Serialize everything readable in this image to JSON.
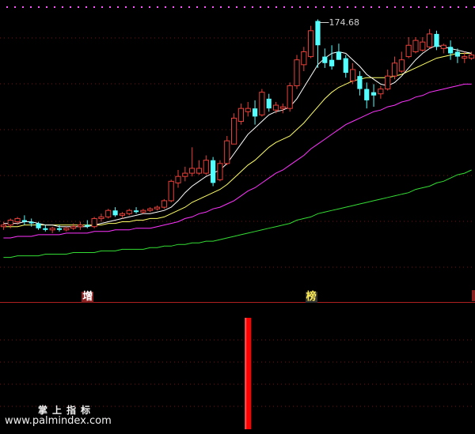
{
  "chart_data": {
    "type": "candlestick",
    "price_high_label": "174.68",
    "price_range": [
      20,
      185
    ],
    "candles": [
      {
        "o": 48,
        "h": 50,
        "l": 45,
        "c": 47,
        "up": true
      },
      {
        "o": 48,
        "h": 52,
        "l": 46,
        "c": 51,
        "up": true
      },
      {
        "o": 50,
        "h": 53,
        "l": 48,
        "c": 52,
        "up": true
      },
      {
        "o": 51,
        "h": 54,
        "l": 48,
        "c": 50,
        "up": false
      },
      {
        "o": 50,
        "h": 52,
        "l": 47,
        "c": 49,
        "up": false
      },
      {
        "o": 49,
        "h": 50,
        "l": 45,
        "c": 46,
        "up": false
      },
      {
        "o": 46,
        "h": 48,
        "l": 44,
        "c": 45,
        "up": false
      },
      {
        "o": 45,
        "h": 47,
        "l": 43,
        "c": 46,
        "up": true
      },
      {
        "o": 46,
        "h": 48,
        "l": 44,
        "c": 45,
        "up": false
      },
      {
        "o": 45,
        "h": 47,
        "l": 44,
        "c": 46,
        "up": true
      },
      {
        "o": 46,
        "h": 49,
        "l": 45,
        "c": 47,
        "up": true
      },
      {
        "o": 47,
        "h": 50,
        "l": 45,
        "c": 48,
        "up": true
      },
      {
        "o": 48,
        "h": 51,
        "l": 46,
        "c": 47,
        "up": false
      },
      {
        "o": 47,
        "h": 53,
        "l": 46,
        "c": 52,
        "up": true
      },
      {
        "o": 52,
        "h": 55,
        "l": 50,
        "c": 53,
        "up": true
      },
      {
        "o": 53,
        "h": 58,
        "l": 52,
        "c": 57,
        "up": true
      },
      {
        "o": 57,
        "h": 59,
        "l": 53,
        "c": 54,
        "up": false
      },
      {
        "o": 54,
        "h": 56,
        "l": 52,
        "c": 55,
        "up": true
      },
      {
        "o": 55,
        "h": 58,
        "l": 54,
        "c": 57,
        "up": true
      },
      {
        "o": 57,
        "h": 59,
        "l": 55,
        "c": 56,
        "up": false
      },
      {
        "o": 56,
        "h": 58,
        "l": 55,
        "c": 57,
        "up": true
      },
      {
        "o": 57,
        "h": 59,
        "l": 56,
        "c": 58,
        "up": true
      },
      {
        "o": 58,
        "h": 60,
        "l": 57,
        "c": 59,
        "up": true
      },
      {
        "o": 59,
        "h": 64,
        "l": 58,
        "c": 63,
        "up": true
      },
      {
        "o": 63,
        "h": 76,
        "l": 62,
        "c": 75,
        "up": true
      },
      {
        "o": 74,
        "h": 82,
        "l": 71,
        "c": 78,
        "up": true
      },
      {
        "o": 78,
        "h": 84,
        "l": 75,
        "c": 80,
        "up": true
      },
      {
        "o": 80,
        "h": 96,
        "l": 78,
        "c": 83,
        "up": true
      },
      {
        "o": 83,
        "h": 88,
        "l": 79,
        "c": 80,
        "up": true
      },
      {
        "o": 80,
        "h": 91,
        "l": 79,
        "c": 88,
        "up": true
      },
      {
        "o": 88,
        "h": 90,
        "l": 72,
        "c": 74,
        "up": false
      },
      {
        "o": 76,
        "h": 88,
        "l": 75,
        "c": 86,
        "up": true
      },
      {
        "o": 86,
        "h": 103,
        "l": 85,
        "c": 100,
        "up": true
      },
      {
        "o": 98,
        "h": 117,
        "l": 98,
        "c": 114,
        "up": true
      },
      {
        "o": 112,
        "h": 123,
        "l": 110,
        "c": 120,
        "up": true
      },
      {
        "o": 118,
        "h": 124,
        "l": 115,
        "c": 120,
        "up": true
      },
      {
        "o": 120,
        "h": 125,
        "l": 110,
        "c": 115,
        "up": false
      },
      {
        "o": 116,
        "h": 132,
        "l": 115,
        "c": 130,
        "up": true
      },
      {
        "o": 126,
        "h": 129,
        "l": 118,
        "c": 120,
        "up": false
      },
      {
        "o": 119,
        "h": 124,
        "l": 117,
        "c": 122,
        "up": true
      },
      {
        "o": 121,
        "h": 123,
        "l": 117,
        "c": 120,
        "up": true
      },
      {
        "o": 120,
        "h": 136,
        "l": 118,
        "c": 134,
        "up": true
      },
      {
        "o": 134,
        "h": 153,
        "l": 132,
        "c": 150,
        "up": true
      },
      {
        "o": 147,
        "h": 158,
        "l": 143,
        "c": 155,
        "up": true
      },
      {
        "o": 152,
        "h": 171,
        "l": 151,
        "c": 168,
        "up": true
      },
      {
        "o": 174,
        "h": 175,
        "l": 145,
        "c": 159,
        "up": false
      },
      {
        "o": 152,
        "h": 157,
        "l": 145,
        "c": 148,
        "up": false
      },
      {
        "o": 150,
        "h": 159,
        "l": 144,
        "c": 146,
        "up": false
      },
      {
        "o": 155,
        "h": 160,
        "l": 150,
        "c": 150,
        "up": false
      },
      {
        "o": 151,
        "h": 153,
        "l": 139,
        "c": 142,
        "up": false
      },
      {
        "o": 144,
        "h": 148,
        "l": 135,
        "c": 137,
        "up": true
      },
      {
        "o": 140,
        "h": 143,
        "l": 128,
        "c": 132,
        "up": false
      },
      {
        "o": 132,
        "h": 136,
        "l": 120,
        "c": 125,
        "up": false
      },
      {
        "o": 128,
        "h": 135,
        "l": 121,
        "c": 130,
        "up": false
      },
      {
        "o": 129,
        "h": 134,
        "l": 126,
        "c": 132,
        "up": true
      },
      {
        "o": 132,
        "h": 144,
        "l": 131,
        "c": 140,
        "up": true
      },
      {
        "o": 140,
        "h": 152,
        "l": 138,
        "c": 148,
        "up": true
      },
      {
        "o": 143,
        "h": 155,
        "l": 142,
        "c": 150,
        "up": true
      },
      {
        "o": 152,
        "h": 164,
        "l": 151,
        "c": 159,
        "up": true
      },
      {
        "o": 155,
        "h": 164,
        "l": 154,
        "c": 162,
        "up": true
      },
      {
        "o": 161,
        "h": 164,
        "l": 155,
        "c": 156,
        "up": true
      },
      {
        "o": 158,
        "h": 169,
        "l": 157,
        "c": 166,
        "up": true
      },
      {
        "o": 166,
        "h": 168,
        "l": 156,
        "c": 158,
        "up": false
      },
      {
        "o": 159,
        "h": 160,
        "l": 154,
        "c": 157,
        "up": true
      },
      {
        "o": 158,
        "h": 162,
        "l": 150,
        "c": 154,
        "up": false
      },
      {
        "o": 155,
        "h": 157,
        "l": 148,
        "c": 152,
        "up": false
      },
      {
        "o": 152,
        "h": 155,
        "l": 148,
        "c": 151,
        "up": true
      },
      {
        "o": 151,
        "h": 155,
        "l": 150,
        "c": 153,
        "up": true
      }
    ],
    "ma_short": [
      49,
      49,
      49,
      50,
      50,
      49,
      48,
      48,
      47,
      47,
      47,
      47,
      47,
      48,
      49,
      50,
      51,
      52,
      53,
      54,
      55,
      55,
      56,
      57,
      59,
      63,
      68,
      72,
      75,
      78,
      80,
      82,
      86,
      92,
      98,
      104,
      108,
      112,
      116,
      118,
      119,
      121,
      126,
      133,
      140,
      147,
      151,
      154,
      155,
      154,
      150,
      146,
      141,
      138,
      135,
      134,
      136,
      140,
      145,
      150,
      154,
      157,
      159,
      158,
      157,
      156,
      155,
      154
    ],
    "ma_mid": [
      47,
      47,
      47,
      48,
      48,
      48,
      48,
      48,
      48,
      48,
      48,
      48,
      48,
      48,
      48,
      49,
      49,
      50,
      50,
      51,
      51,
      52,
      52,
      53,
      55,
      57,
      59,
      62,
      64,
      66,
      68,
      70,
      73,
      77,
      81,
      85,
      88,
      92,
      96,
      99,
      101,
      103,
      107,
      111,
      116,
      121,
      126,
      130,
      133,
      135,
      137,
      138,
      139,
      139,
      139,
      139,
      140,
      141,
      143,
      145,
      147,
      149,
      151,
      152,
      153,
      154,
      154,
      154
    ],
    "ma_60": [
      40,
      40,
      41,
      41,
      41,
      42,
      42,
      42,
      42,
      43,
      43,
      43,
      43,
      44,
      44,
      44,
      45,
      45,
      45,
      46,
      46,
      46,
      47,
      48,
      49,
      50,
      52,
      53,
      55,
      56,
      58,
      59,
      61,
      63,
      66,
      69,
      71,
      74,
      77,
      80,
      82,
      85,
      88,
      91,
      95,
      98,
      101,
      104,
      107,
      110,
      112,
      114,
      116,
      118,
      119,
      121,
      122,
      124,
      125,
      127,
      128,
      130,
      131,
      132,
      133,
      134,
      135,
      135
    ],
    "ma_long": [
      28,
      28,
      29,
      29,
      29,
      29,
      30,
      30,
      30,
      30,
      31,
      31,
      31,
      31,
      32,
      32,
      32,
      33,
      33,
      33,
      33,
      34,
      34,
      35,
      35,
      36,
      36,
      37,
      37,
      38,
      38,
      39,
      40,
      41,
      42,
      43,
      44,
      45,
      46,
      47,
      48,
      49,
      51,
      52,
      53,
      55,
      56,
      57,
      58,
      59,
      60,
      61,
      62,
      63,
      64,
      65,
      66,
      67,
      68,
      70,
      71,
      72,
      74,
      75,
      77,
      79,
      80,
      82
    ],
    "signals": [
      {
        "label": "增",
        "index": 12
      },
      {
        "label": "榜",
        "index": 44
      }
    ],
    "indicator_bar": {
      "index": 35,
      "value": 1
    },
    "colors": {
      "up": "#e8403a",
      "down": "#54ffff",
      "ma_short": "#ffffff",
      "ma_mid": "#ffff66",
      "ma_60": "#ff33ff",
      "ma_long": "#33dd33",
      "grid": "#7a1010",
      "indicator_bar": "#ff0000"
    }
  },
  "watermark": {
    "line1": "掌上指标",
    "line2": "www.palmindex.com"
  }
}
